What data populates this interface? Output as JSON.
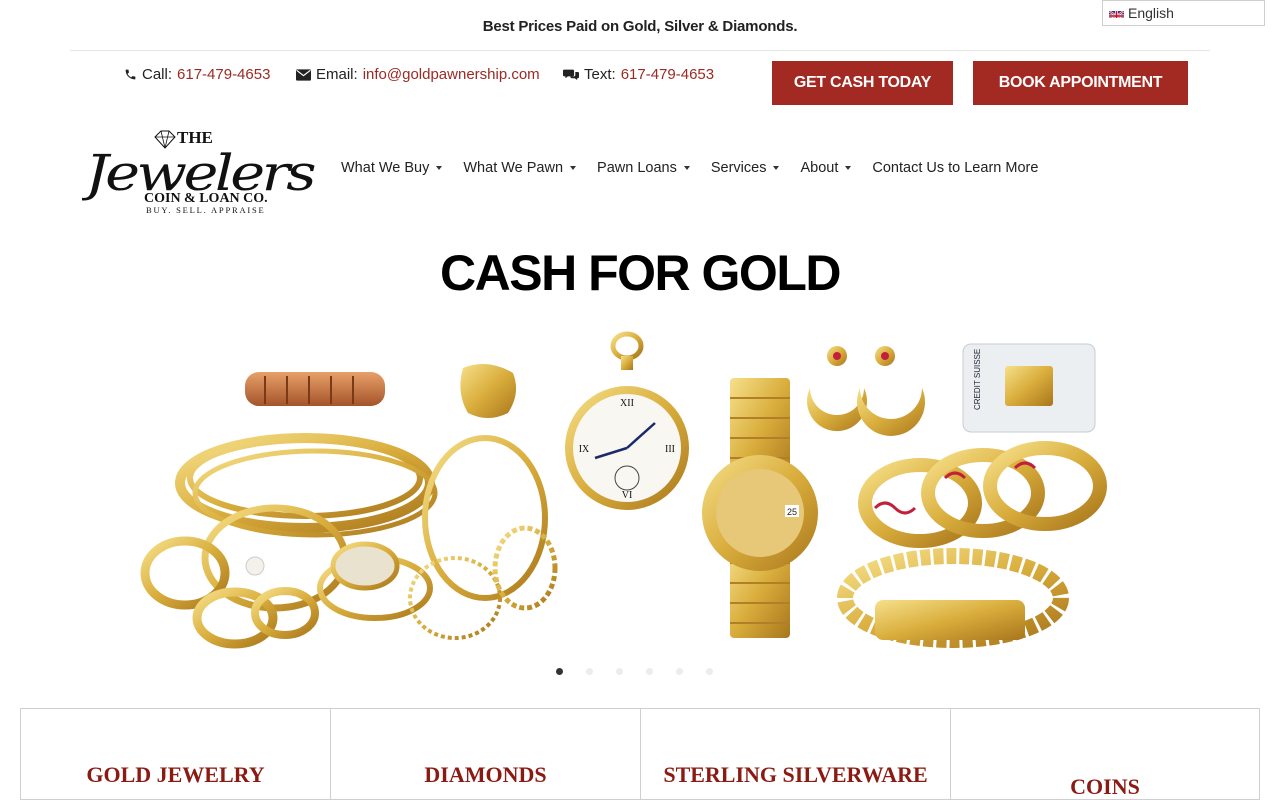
{
  "topbar": {
    "tagline": "Best Prices Paid on Gold, Silver & Diamonds.",
    "language": "English"
  },
  "contact": {
    "call_label": "Call:",
    "call_value": "617-479-4653",
    "email_label": "Email:",
    "email_value": "info@goldpawnership.com",
    "text_label": "Text:",
    "text_value": "617-479-4653"
  },
  "buttons": {
    "get_cash": "GET CASH TODAY",
    "book": "BOOK APPOINTMENT"
  },
  "logo": {
    "the": "THE",
    "name": "Jewelers",
    "subtitle": "COIN & LOAN CO.",
    "tagline": "BUY. SELL. APPRAISE"
  },
  "nav": [
    {
      "label": "What We Buy",
      "has_dropdown": true
    },
    {
      "label": "What We Pawn",
      "has_dropdown": true
    },
    {
      "label": "Pawn Loans",
      "has_dropdown": true
    },
    {
      "label": "Services",
      "has_dropdown": true
    },
    {
      "label": "About",
      "has_dropdown": true
    },
    {
      "label": "Contact Us to Learn More",
      "has_dropdown": false
    }
  ],
  "hero": {
    "title": "CASH FOR GOLD",
    "slide_count": 6,
    "active_slide": 1,
    "bar_brand": "CREDIT SUISSE"
  },
  "categories": [
    {
      "title": "GOLD JEWELRY"
    },
    {
      "title": "DIAMONDS"
    },
    {
      "title": "STERLING SILVERWARE"
    },
    {
      "title": "COINS"
    }
  ],
  "colors": {
    "accent": "#a32a22",
    "link": "#9b2a24",
    "card_title": "#8a1a12",
    "gold": "#d9ad3c"
  }
}
